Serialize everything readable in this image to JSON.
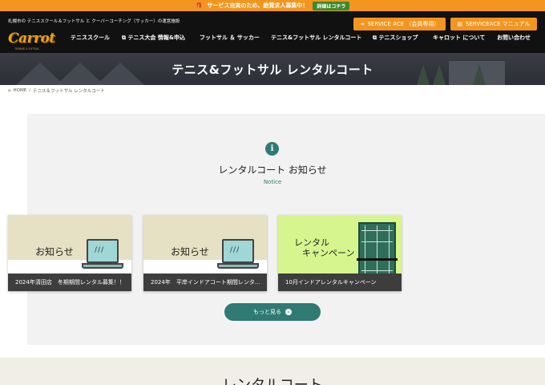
{
  "topbar": {
    "message": "サービス充実のため、絶賛求人募集中！",
    "detail_button": "詳細はコチラ"
  },
  "header": {
    "tagline": "札幌市の テニススクール＆フットサル と クーバーコーチング（サッカー）の運営施設",
    "logo_text": "Carrot",
    "logo_sub": "TENNIS & FUTSAL",
    "service_ace_button": "SERVICE ACE （会員専用）",
    "service_ace_manual_button": "SERVICEACE マニュアル",
    "nav": [
      {
        "label": "テニススクール"
      },
      {
        "label": "テニス大会 情報&申込"
      },
      {
        "label": "フットサル ＆ サッカー"
      },
      {
        "label": "テニス&フットサル レンタルコート"
      },
      {
        "label": "テニスショップ"
      },
      {
        "label": "キャロット について"
      },
      {
        "label": "お問い合わせ"
      }
    ]
  },
  "hero": {
    "title": "テニス&フットサル レンタルコート"
  },
  "breadcrumb": {
    "home": "HOME",
    "separator": "/",
    "current": "テニス＆フットサル レンタルコート"
  },
  "notice": {
    "icon": "info-icon",
    "title": "レンタルコート お知らせ",
    "subtitle": "Notice",
    "cards": [
      {
        "image_label": "お知らせ",
        "caption": "2024年清田店　冬期期間レンタル募集！！"
      },
      {
        "image_label": "お知らせ",
        "caption": "2024年　平岸インドアコート期間レンタ..."
      },
      {
        "image_label_line1": "レンタル",
        "image_label_line2": "キャンペーン",
        "caption": "10月インドアレンタルキャンペーン"
      }
    ],
    "more_button": "もっと見る"
  },
  "bottom": {
    "title": "レンタルコート"
  },
  "colors": {
    "accent_orange": "#f2961f",
    "teal": "#2f7a72",
    "header_bg": "#111111",
    "card_beige": "#e6e0c4",
    "card_green": "#d6f58e"
  }
}
